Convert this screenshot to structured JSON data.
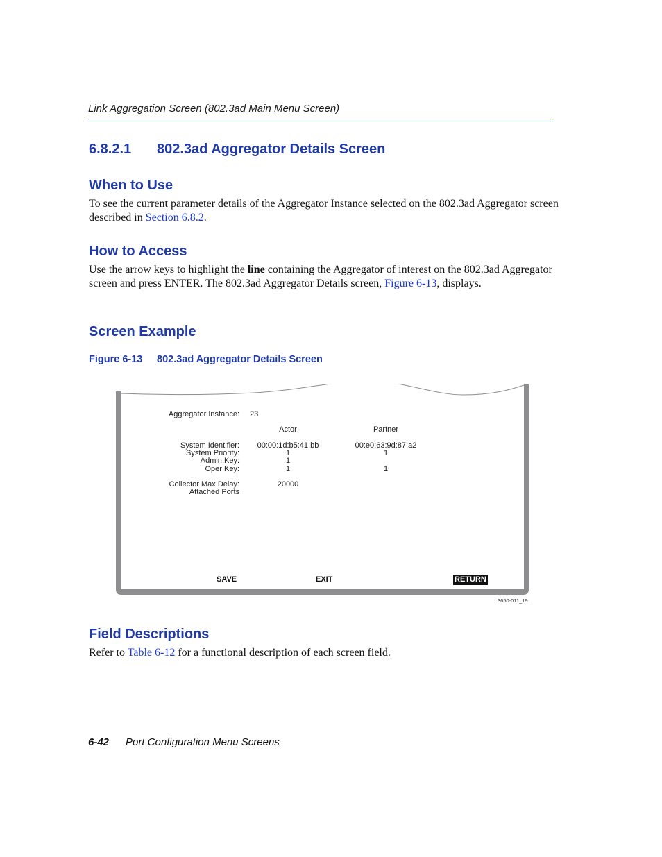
{
  "running_header": "Link Aggregation Screen (802.3ad Main Menu Screen)",
  "section": {
    "number": "6.8.2.1",
    "title": "802.3ad Aggregator Details Screen"
  },
  "when_to_use": {
    "heading": "When to Use",
    "text_before": "To see the current parameter details of the Aggregator Instance selected on the 802.3ad Aggregator screen described in ",
    "link": "Section 6.8.2",
    "text_after": "."
  },
  "how_to_access": {
    "heading": "How to Access",
    "text_1": "Use the arrow keys to highlight the ",
    "bold": "line",
    "text_2": " containing the Aggregator of interest on the 802.3ad Aggregator screen and press ENTER. The 802.3ad Aggregator Details screen, ",
    "link": "Figure 6-13",
    "text_3": ", displays."
  },
  "screen_example": {
    "heading": "Screen Example"
  },
  "figure": {
    "number": "Figure 6-13",
    "title": "802.3ad Aggregator Details Screen",
    "id": "3650-011_19",
    "screen": {
      "instance_label": "Aggregator Instance:",
      "instance_value": "23",
      "col_actor": "Actor",
      "col_partner": "Partner",
      "rows": [
        {
          "label": "System Identifier:",
          "actor": "00:00:1d:b5:41:bb",
          "partner": "00:e0:63:9d:87:a2"
        },
        {
          "label": "System Priority:",
          "actor": "1",
          "partner": "1"
        },
        {
          "label": "Admin Key:",
          "actor": "1",
          "partner": ""
        },
        {
          "label": "Oper Key:",
          "actor": "1",
          "partner": "1"
        }
      ],
      "collector_label": "Collector Max Delay:",
      "collector_value": "20000",
      "attached_label": "Attached Ports",
      "buttons": {
        "save": "SAVE",
        "exit": "EXIT",
        "return": "RETURN"
      }
    }
  },
  "field_descriptions": {
    "heading": "Field Descriptions",
    "text_before": "Refer to ",
    "link": "Table 6-12",
    "text_after": " for a functional description of each screen field."
  },
  "footer": {
    "page_number": "6-42",
    "chapter": "Port Configuration Menu Screens"
  }
}
